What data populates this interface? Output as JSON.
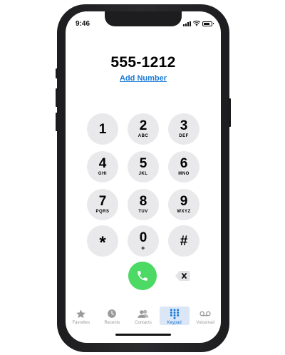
{
  "status": {
    "time": "9:46"
  },
  "dialer": {
    "number": "555-1212",
    "add_number": "Add Number"
  },
  "keys": [
    {
      "digit": "1",
      "letters": ""
    },
    {
      "digit": "2",
      "letters": "ABC"
    },
    {
      "digit": "3",
      "letters": "DEF"
    },
    {
      "digit": "4",
      "letters": "GHI"
    },
    {
      "digit": "5",
      "letters": "JKL"
    },
    {
      "digit": "6",
      "letters": "MNO"
    },
    {
      "digit": "7",
      "letters": "PQRS"
    },
    {
      "digit": "8",
      "letters": "TUV"
    },
    {
      "digit": "9",
      "letters": "WXYZ"
    },
    {
      "digit": "*",
      "letters": ""
    },
    {
      "digit": "0",
      "letters": "+"
    },
    {
      "digit": "#",
      "letters": ""
    }
  ],
  "tabs": [
    {
      "label": "Favorites",
      "icon": "star-icon"
    },
    {
      "label": "Recents",
      "icon": "clock-icon"
    },
    {
      "label": "Contacts",
      "icon": "contacts-icon"
    },
    {
      "label": "Keypad",
      "icon": "keypad-icon",
      "active": true
    },
    {
      "label": "Voicemail",
      "icon": "voicemail-icon"
    }
  ],
  "colors": {
    "call": "#4cd964",
    "accent": "#1a7ad8",
    "key_bg": "#e9e9eb"
  }
}
